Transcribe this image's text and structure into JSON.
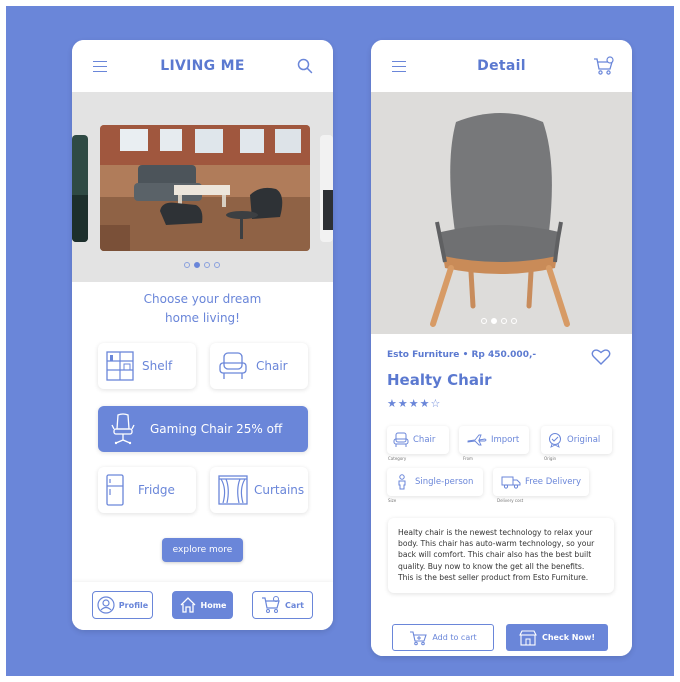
{
  "home": {
    "title": "LIVING ME",
    "tagline_line1": "Choose your dream",
    "tagline_line2": "home living!",
    "categories": [
      {
        "label": "Shelf",
        "icon": "shelf-icon"
      },
      {
        "label": "Chair",
        "icon": "chair-icon"
      },
      {
        "label": "Gaming Chair 25% off",
        "icon": "gaming-chair-icon"
      },
      {
        "label": "Fridge",
        "icon": "fridge-icon"
      },
      {
        "label": "Curtains",
        "icon": "curtains-icon"
      }
    ],
    "explore_label": "explore more",
    "nav": {
      "profile": "Profile",
      "home": "Home",
      "cart": "Cart"
    }
  },
  "detail": {
    "title": "Detail",
    "brand": "Esto Furniture",
    "price": "Rp 450.000,-",
    "name": "Healty Chair",
    "rating_stars": 4.5,
    "stars_text": "★★★★☆",
    "specs": [
      {
        "label": "Chair",
        "sub": "Category"
      },
      {
        "label": "Import",
        "sub": "From"
      },
      {
        "label": "Original",
        "sub": "Origin"
      },
      {
        "label": "Single-person",
        "sub": "Size"
      },
      {
        "label": "Free Delivery",
        "sub": "Delivery cost"
      }
    ],
    "description_lines": [
      "Healty chair is the newest technology to relax your",
      "body. This chair has auto-warm technology, so your",
      "back will comfort. This chair also has the best built",
      "quality. Buy now to know the get all the benefits.",
      "This is the best seller product from Esto Furniture."
    ],
    "add_to_cart": "Add to cart",
    "check_now": "Check Now!"
  },
  "colors": {
    "accent": "#6a86d9",
    "background": "#6a86d9",
    "card": "#ffffff"
  }
}
